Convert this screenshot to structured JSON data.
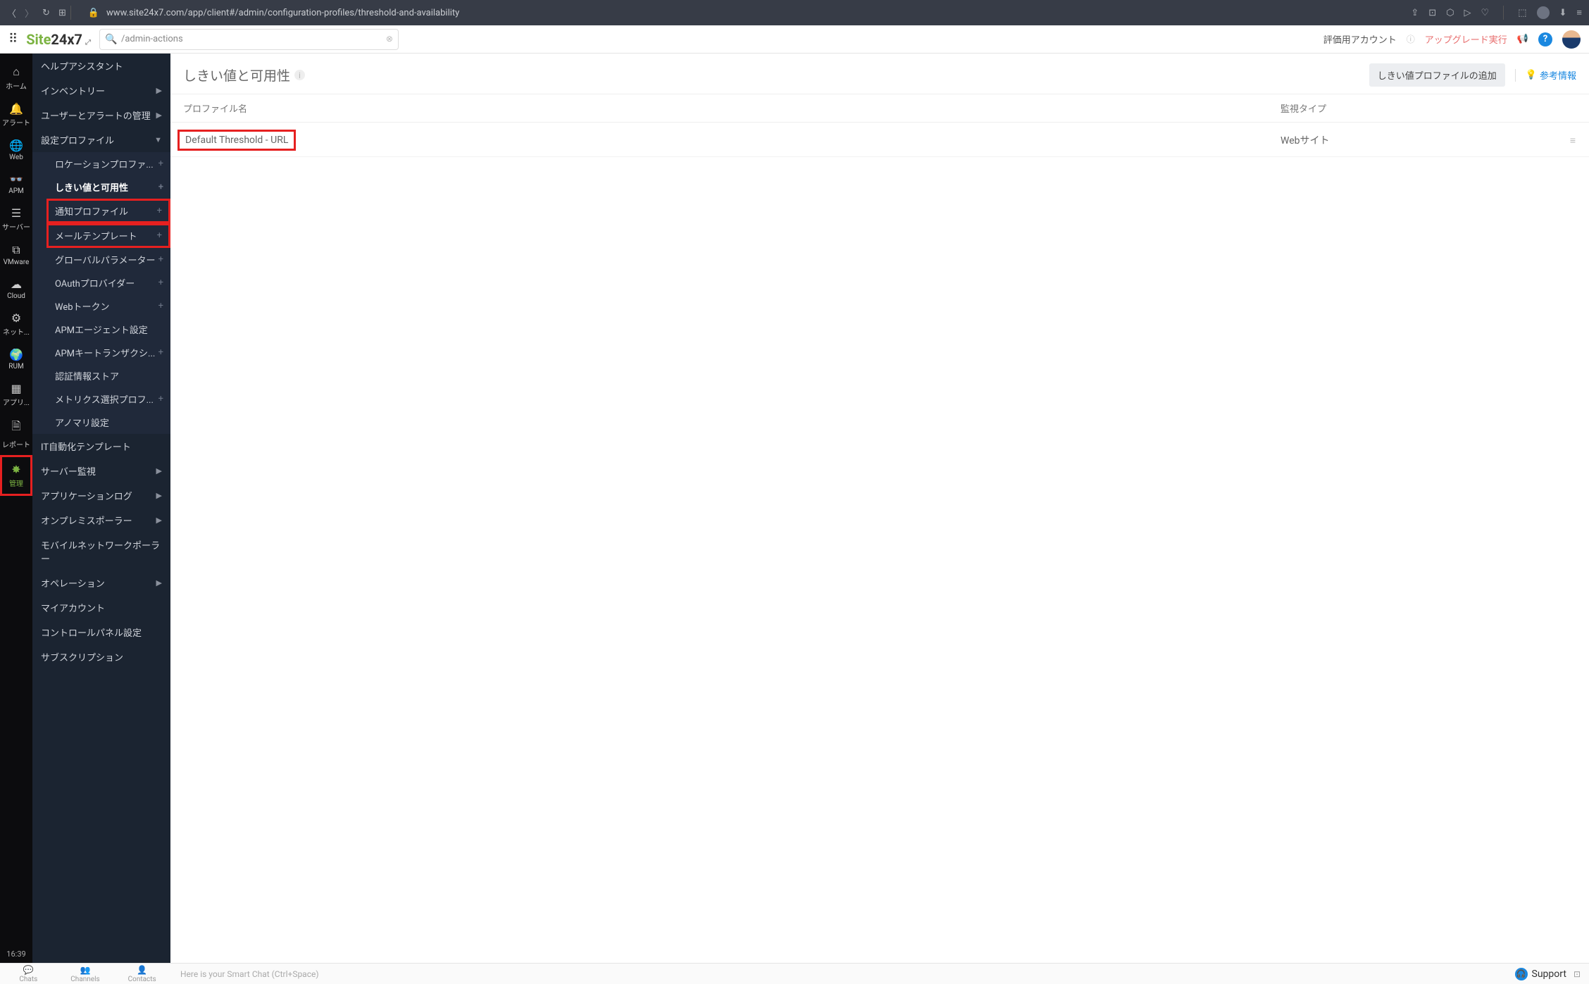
{
  "browser": {
    "url": "www.site24x7.com/app/client#/admin/configuration-profiles/threshold-and-availability"
  },
  "app": {
    "logo_green": "Site",
    "logo_dark": "24x7",
    "search_placeholder": "/admin-actions",
    "eval_account": "評価用アカウント",
    "upgrade": "アップグレード実行"
  },
  "rail": {
    "items": [
      {
        "label": "ホーム",
        "icon": "⌂"
      },
      {
        "label": "アラート",
        "icon": "🔔"
      },
      {
        "label": "Web",
        "icon": "🌐"
      },
      {
        "label": "APM",
        "icon": "👓"
      },
      {
        "label": "サーバー",
        "icon": "☰"
      },
      {
        "label": "VMware",
        "icon": "⧉"
      },
      {
        "label": "Cloud",
        "icon": "☁"
      },
      {
        "label": "ネット...",
        "icon": "⚙"
      },
      {
        "label": "RUM",
        "icon": "🌍"
      },
      {
        "label": "アプリ...",
        "icon": "▦"
      },
      {
        "label": "レポート",
        "icon": "🗎"
      },
      {
        "label": "管理",
        "icon": "✸"
      }
    ],
    "time": "16:39"
  },
  "sidebar": {
    "top": [
      {
        "label": "ヘルプアシスタント"
      },
      {
        "label": "インベントリー",
        "chev": true
      },
      {
        "label": "ユーザーとアラートの管理",
        "chev": true
      }
    ],
    "config_header": "設定プロファイル",
    "config_items": [
      {
        "label": "ロケーションプロファ...",
        "plus": true
      },
      {
        "label": "しきい値と可用性",
        "plus": true,
        "active": true
      },
      {
        "label": "通知プロファイル",
        "plus": true,
        "highlight": true
      },
      {
        "label": "メールテンプレート",
        "plus": true,
        "highlight": true
      },
      {
        "label": "グローバルパラメーター",
        "plus": true
      },
      {
        "label": "OAuthプロバイダー",
        "plus": true
      },
      {
        "label": "Webトークン",
        "plus": true
      },
      {
        "label": "APMエージェント設定"
      },
      {
        "label": "APMキートランザクシ...",
        "plus": true
      },
      {
        "label": "認証情報ストア"
      },
      {
        "label": "メトリクス選択プロフ...",
        "plus": true
      },
      {
        "label": "アノマリ設定"
      }
    ],
    "bottom": [
      {
        "label": "IT自動化テンプレート"
      },
      {
        "label": "サーバー監視",
        "chev": true
      },
      {
        "label": "アプリケーションログ",
        "chev": true
      },
      {
        "label": "オンプレミスポーラー",
        "chev": true
      },
      {
        "label": "モバイルネットワークポーラー"
      },
      {
        "label": "オペレーション",
        "chev": true
      },
      {
        "label": "マイアカウント"
      },
      {
        "label": "コントロールパネル設定"
      },
      {
        "label": "サブスクリプション"
      }
    ]
  },
  "content": {
    "title": "しきい値と可用性",
    "add_button": "しきい値プロファイルの追加",
    "ref_link": "参考情報",
    "columns": {
      "name": "プロファイル名",
      "type": "監視タイプ"
    },
    "rows": [
      {
        "name": "Default Threshold - URL",
        "type": "Webサイト",
        "highlight": true
      }
    ]
  },
  "bottom": {
    "tabs": [
      {
        "label": "Chats",
        "icon": "💬"
      },
      {
        "label": "Channels",
        "icon": "👥"
      },
      {
        "label": "Contacts",
        "icon": "👤"
      }
    ],
    "smart_chat": "Here is your Smart Chat (Ctrl+Space)",
    "support": "Support"
  }
}
